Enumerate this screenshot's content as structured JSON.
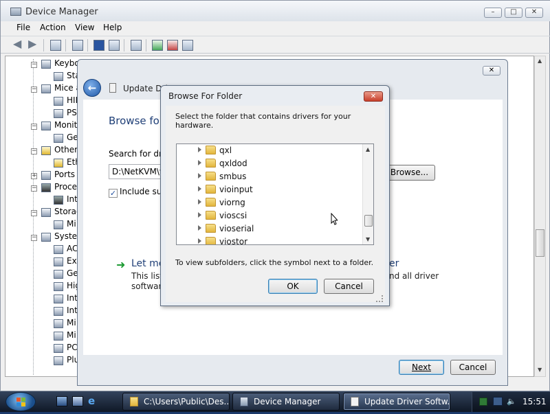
{
  "device_manager": {
    "title": "Device Manager",
    "menu": [
      "File",
      "Action",
      "View",
      "Help"
    ],
    "tree": [
      {
        "label": "Keybo"
      },
      {
        "label": "Sta"
      },
      {
        "label": "Mice a"
      },
      {
        "label": "HID"
      },
      {
        "label": "PS/"
      },
      {
        "label": "Monito"
      },
      {
        "label": "Ge"
      },
      {
        "label": "Other"
      },
      {
        "label": "Eth"
      },
      {
        "label": "Ports ("
      },
      {
        "label": "Proces"
      },
      {
        "label": "Int"
      },
      {
        "label": "Storag"
      },
      {
        "label": "Mi"
      },
      {
        "label": "System"
      },
      {
        "label": "AC"
      },
      {
        "label": "Ext"
      },
      {
        "label": "Ge"
      },
      {
        "label": "Hig"
      },
      {
        "label": "Int"
      },
      {
        "label": "Int"
      },
      {
        "label": "Mi"
      },
      {
        "label": "Mi"
      },
      {
        "label": "PC"
      },
      {
        "label": "Plu"
      }
    ]
  },
  "update_driver": {
    "title": "Update Dri",
    "heading": "Browse for",
    "search_label": "Search for driv",
    "path_value": "D:\\NetKVM\\w",
    "browse_label": "Browse...",
    "include_label": "Include sub",
    "let_me": "Let me",
    "list_line1": "This list",
    "list_line2": "software",
    "right_text1": "er",
    "right_text2": "nd all driver",
    "next_label": "Next",
    "cancel_label": "Cancel"
  },
  "browse_folder": {
    "title": "Browse For Folder",
    "instruction": "Select the folder that contains drivers for your hardware.",
    "folders": [
      "qxl",
      "qxldod",
      "smbus",
      "vioinput",
      "viorng",
      "vioscsi",
      "vioserial",
      "viostor"
    ],
    "hint": "To view subfolders, click the symbol next to a folder.",
    "ok_label": "OK",
    "cancel_label": "Cancel"
  },
  "taskbar": {
    "tasks": [
      {
        "label": "C:\\Users\\Public\\Des..."
      },
      {
        "label": "Device Manager"
      },
      {
        "label": "Update Driver Softw..."
      }
    ],
    "clock": "15:51"
  }
}
